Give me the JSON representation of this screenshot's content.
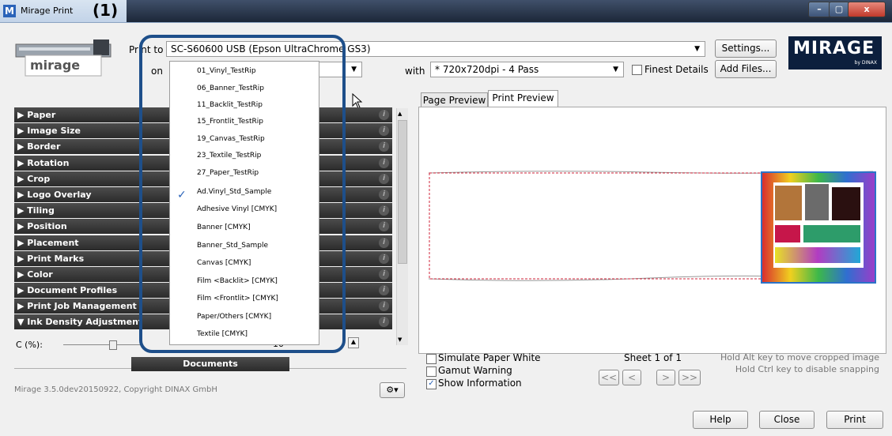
{
  "window": {
    "title": "Mirage Print",
    "app_icon": "M",
    "minimize": "–",
    "maximize": "▢",
    "close": "x"
  },
  "callout": "(1)",
  "printer_logo_text": "mirage",
  "print_to": {
    "label": "Print to",
    "value": "SC-S60600 USB (Epson UltraChrome GS3)"
  },
  "on": {
    "label": "on"
  },
  "with": {
    "label": "with",
    "value": "* 720x720dpi - 4 Pass"
  },
  "finest_details": {
    "label": "Finest Details",
    "checked": false
  },
  "buttons": {
    "settings": "Settings...",
    "add_files": "Add Files...",
    "help": "Help",
    "close": "Close",
    "print": "Print"
  },
  "brand": {
    "name": "MIRAGE",
    "sub": "by DINAX"
  },
  "sections": [
    "Paper",
    "Image Size",
    "Border",
    "Rotation",
    "Crop",
    "Logo Overlay",
    "Tiling",
    "Position",
    "Placement",
    "Print Marks",
    "Color",
    "Document Profiles",
    "Print Job Management",
    "Ink Density Adjustment"
  ],
  "ink_row": {
    "label": "C (%):",
    "value": "10"
  },
  "documents_tab": "Documents",
  "copyright": "Mirage 3.5.0dev20150922, Copyright DINAX GmbH",
  "media_list": [
    "01_Vinyl_TestRip",
    "06_Banner_TestRip",
    "11_Backlit_TestRip",
    "15_Frontlit_TestRip",
    "19_Canvas_TestRip",
    "23_Textile_TestRip",
    "27_Paper_TestRip",
    "Ad.Vinyl_Std_Sample",
    "Adhesive Vinyl [CMYK]",
    "Banner [CMYK]",
    "Banner_Std_Sample",
    "Canvas [CMYK]",
    "Film <Backlit> [CMYK]",
    "Film <Frontlit> [CMYK]",
    "Paper/Others [CMYK]",
    "Textile [CMYK]"
  ],
  "media_selected": "Ad.Vinyl_Std_Sample",
  "tabs": {
    "page_preview": "Page Preview",
    "print_preview": "Print Preview"
  },
  "options": {
    "simulate_paper_white": "Simulate Paper White",
    "gamut_warning": "Gamut Warning",
    "show_information": "Show Information",
    "show_information_checked": true
  },
  "sheet": "Sheet 1 of 1",
  "nav": {
    "first": "<<",
    "prev": "<",
    "next": ">",
    "last": ">>"
  },
  "hints": {
    "alt": "Hold Alt key to move cropped image",
    "ctrl": "Hold Ctrl key to disable snapping"
  },
  "colors": {
    "title_dark": "#1c2738",
    "highlight": "#1e4f8a",
    "section": "#2b2b2b",
    "brand_bg": "#0c1f3d",
    "check": "#2a63b9"
  }
}
